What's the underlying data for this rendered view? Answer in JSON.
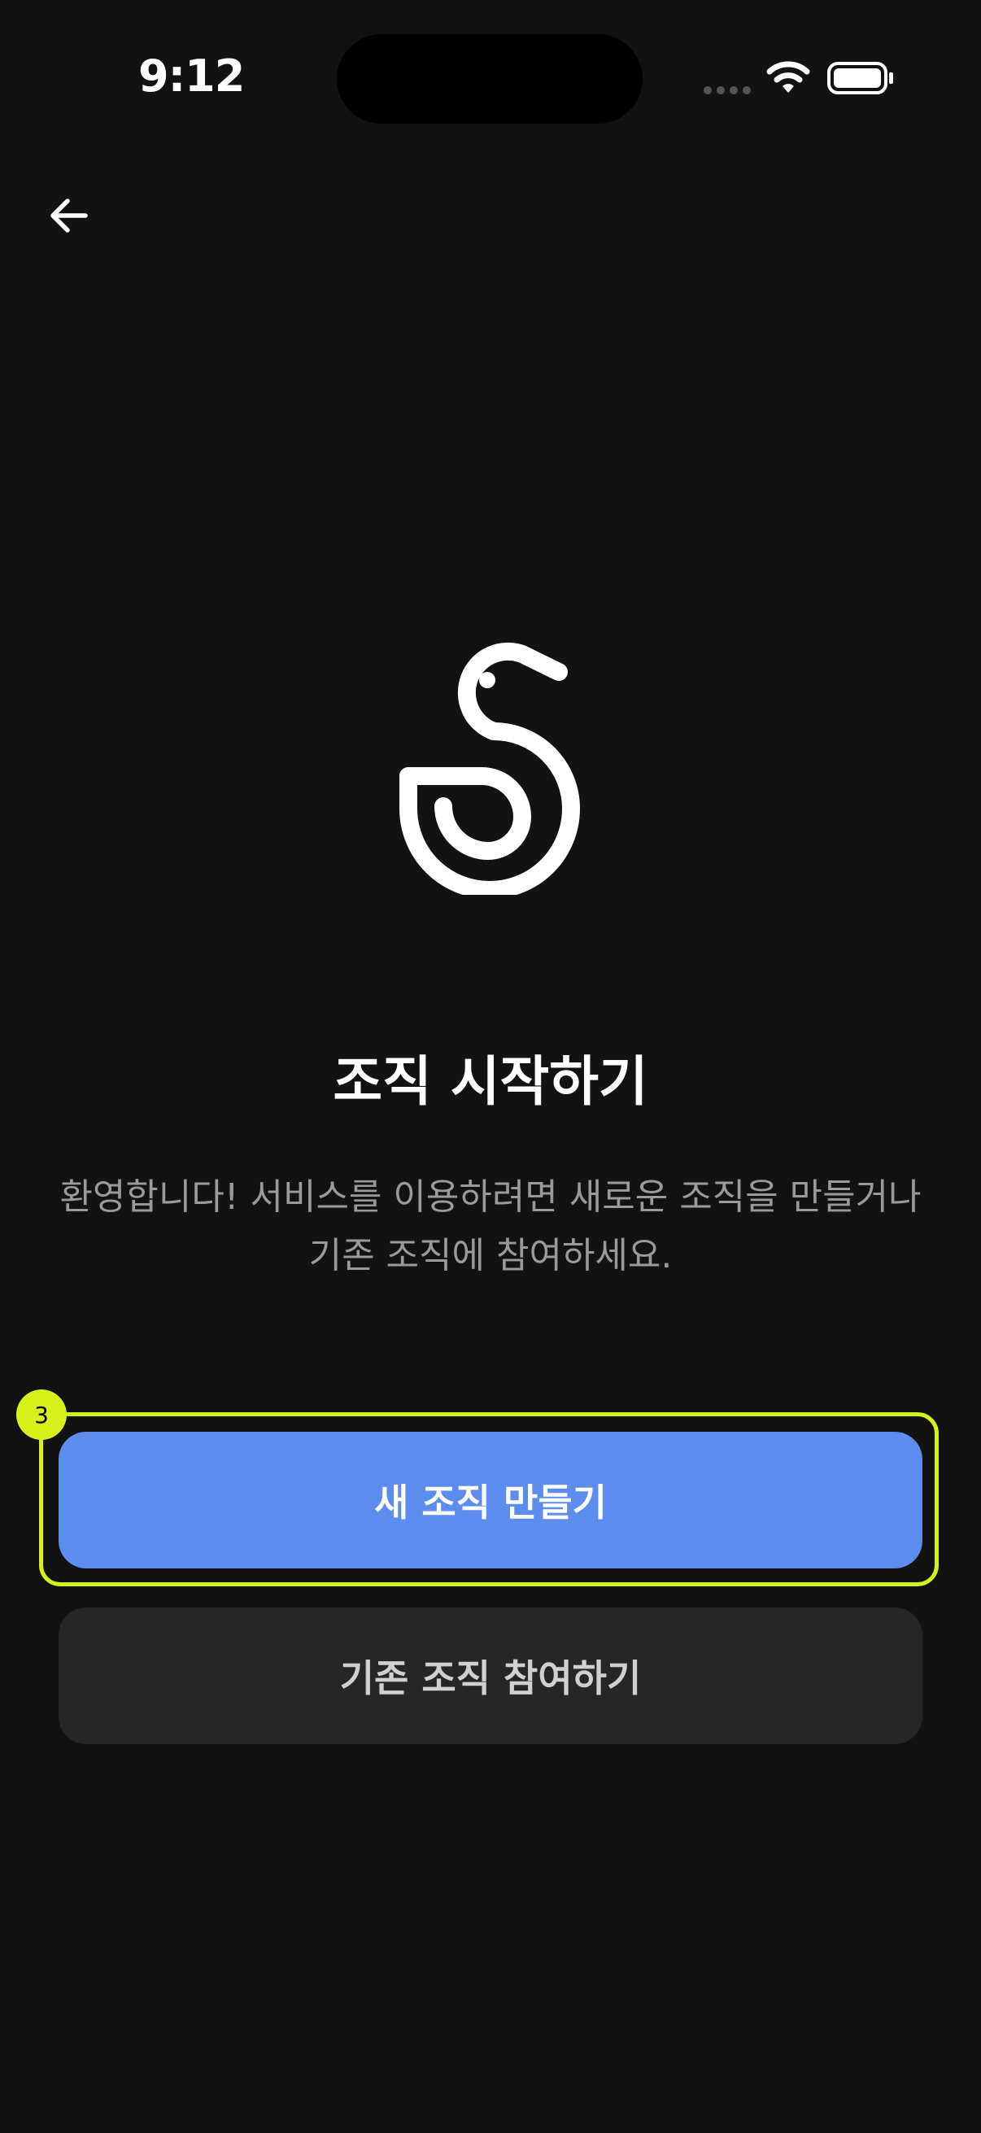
{
  "status_bar": {
    "time": "9:12"
  },
  "colors": {
    "background": "#121212",
    "primary_button": "#5b8cee",
    "secondary_button": "#262626",
    "highlight": "#d7f21a",
    "subtitle_text": "#9a9a9a"
  },
  "icons": {
    "back": "arrow-left-icon",
    "logo": "swan-logo-icon",
    "signal": "cellular-signal-icon",
    "wifi": "wifi-icon",
    "battery": "battery-icon"
  },
  "main": {
    "title": "조직 시작하기",
    "subtitle": "환영합니다! 서비스를 이용하려면 새로운 조직을 만들거나 기존 조직에 참여하세요."
  },
  "actions": {
    "create_label": "새 조직 만들기",
    "join_label": "기존 조직 참여하기"
  },
  "annotation": {
    "badge": "3"
  }
}
